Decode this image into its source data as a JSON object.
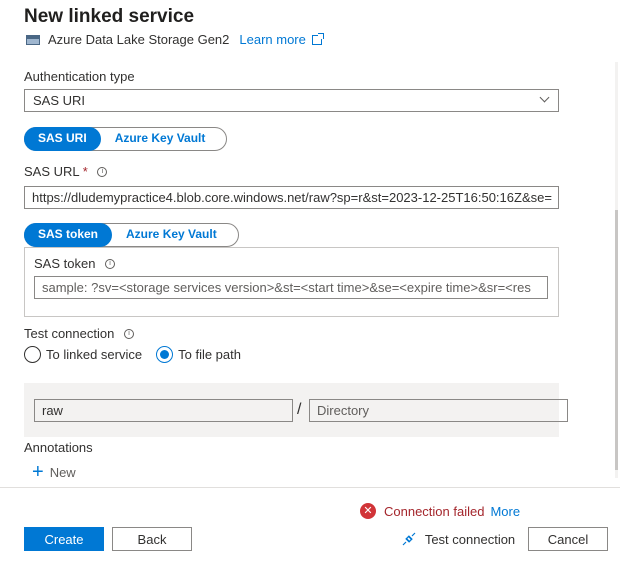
{
  "header": {
    "title": "New linked service",
    "service_name": "Azure Data Lake Storage Gen2",
    "learn_more": "Learn more"
  },
  "auth": {
    "label": "Authentication type",
    "value": "SAS URI"
  },
  "sas_toggle": {
    "options": [
      "SAS URI",
      "Azure Key Vault"
    ],
    "selected": "SAS URI"
  },
  "sas_url": {
    "label": "SAS URL",
    "required_mark": "*",
    "value": "https://dludemypractice4.blob.core.windows.net/raw?sp=r&st=2023-12-25T16:50:16Z&se="
  },
  "token_toggle": {
    "options": [
      "SAS token",
      "Azure Key Vault"
    ],
    "selected": "SAS token"
  },
  "sas_token": {
    "label": "SAS token",
    "placeholder": "sample: ?sv=<storage services version>&st=<start time>&se=<expire time>&sr=<res"
  },
  "test_connection": {
    "label": "Test connection",
    "options": [
      "To linked service",
      "To file path"
    ],
    "selected": "To file path"
  },
  "file_path": {
    "container_value": "raw",
    "separator": "/",
    "directory_placeholder": "Directory"
  },
  "annotations": {
    "label": "Annotations",
    "new_label": "New"
  },
  "footer": {
    "error_text": "Connection failed",
    "more_link": "More",
    "create": "Create",
    "back": "Back",
    "test_connection": "Test connection",
    "cancel": "Cancel"
  },
  "colors": {
    "accent": "#0078d4",
    "error": "#a4262c"
  }
}
